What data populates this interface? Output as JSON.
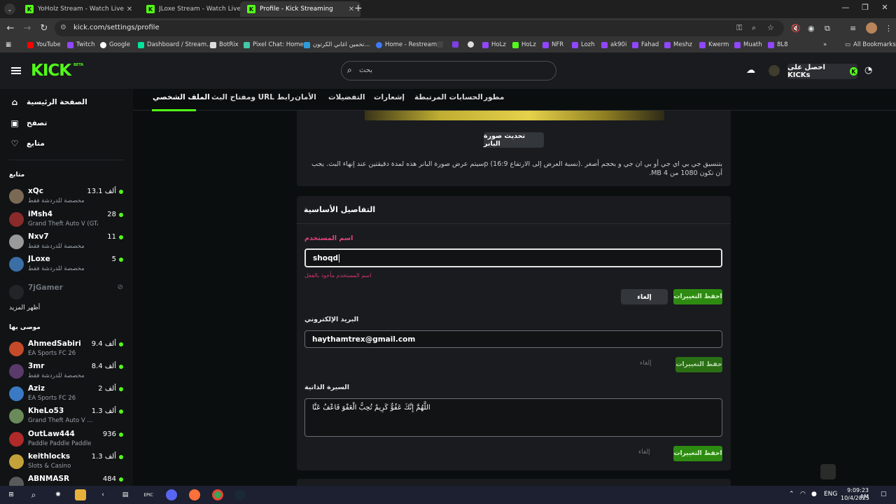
{
  "browser": {
    "tabs": [
      {
        "title": "YoHolz Stream - Watch Live on Kick",
        "active": false
      },
      {
        "title": "JLoxe Stream - Watch Live on Kick",
        "active": false
      },
      {
        "title": "Profile - Kick Streaming",
        "active": true
      }
    ],
    "new_tab_symbol": "+",
    "url": "kick.com/settings/profile",
    "bookmarks": [
      {
        "label": "YouTube",
        "color": "#ff0000"
      },
      {
        "label": "Twitch",
        "color": "#9146ff"
      },
      {
        "label": "Google",
        "color": "#ffffff"
      },
      {
        "label": "Dashboard / Stream...",
        "color": "#00e59b"
      },
      {
        "label": "BotRix",
        "color": "#dddddd"
      },
      {
        "label": "Pixel Chat: Home",
        "color": "#47c7a9"
      },
      {
        "label": "تخمين اغاني الكرتون...",
        "color": "#2d9cdb"
      },
      {
        "label": "Home - Restream",
        "color": "#3c7bff"
      },
      {
        "label": "",
        "color": "#444444"
      },
      {
        "label": "",
        "color": "#7b3fe4"
      },
      {
        "label": "",
        "color": "#dddddd"
      },
      {
        "label": "HoLz",
        "color": "#9146ff"
      },
      {
        "label": "HoLz",
        "color": "#53fc18"
      },
      {
        "label": "NFR",
        "color": "#9146ff"
      },
      {
        "label": "Lozh",
        "color": "#9146ff"
      },
      {
        "label": "ak90i",
        "color": "#9146ff"
      },
      {
        "label": "Fahad",
        "color": "#9146ff"
      },
      {
        "label": "Meshz",
        "color": "#9146ff"
      },
      {
        "label": "Kwerm",
        "color": "#9146ff"
      },
      {
        "label": "Muath",
        "color": "#9146ff"
      },
      {
        "label": "8L8",
        "color": "#9146ff"
      }
    ],
    "more_bookmarks": "»",
    "all_bookmarks": "All Bookmarks"
  },
  "header": {
    "logo": "KICK",
    "logo_badge": "BETA",
    "search_placeholder": "بحث",
    "get_kicks_label": "احصل على KICKs",
    "get_kicks_icon": "K"
  },
  "sidebar": {
    "nav": [
      {
        "label": "الصفحة الرئيسية",
        "icon": "home-icon",
        "glyph": "⌂"
      },
      {
        "label": "تصفح",
        "icon": "browse-icon",
        "glyph": "▣"
      },
      {
        "label": "متابع",
        "icon": "heart-icon",
        "glyph": "♡"
      }
    ],
    "following_heading": "متابع",
    "following": [
      {
        "name": "xQc",
        "category": "مخصصة للدردشة فقط",
        "viewers": "13.1 ألف",
        "live": true,
        "avatar": "#7a6a55"
      },
      {
        "name": "iMsh4",
        "category": "Grand Theft Auto V (GTA)",
        "viewers": "28",
        "live": true,
        "avatar": "#8a2a2a"
      },
      {
        "name": "Nxv7",
        "category": "مخصصة للدردشة فقط",
        "viewers": "11",
        "live": true,
        "avatar": "#9a9a9a"
      },
      {
        "name": "JLoxe",
        "category": "مخصصة للدردشة فقط",
        "viewers": "5",
        "live": true,
        "avatar": "#3a6ea5"
      },
      {
        "name": "7jGamer",
        "category": "",
        "viewers": "",
        "live": false,
        "avatar": "#2a2d31"
      }
    ],
    "show_more": "أظهر المزيد",
    "recommended_heading": "موصى بها",
    "recommended": [
      {
        "name": "AhmedSabiri",
        "category": "EA Sports FC 26",
        "viewers": "9.4 ألف",
        "avatar": "#c44a2a"
      },
      {
        "name": "3mr",
        "category": "مخصصة للدردشة فقط",
        "viewers": "8.4 ألف",
        "avatar": "#5a3a6a"
      },
      {
        "name": "Aziz",
        "category": "EA Sports FC 26",
        "viewers": "2 ألف",
        "avatar": "#3a7ac4"
      },
      {
        "name": "KheLo53",
        "category": "Grand Theft Auto V ...",
        "viewers": "1.3 ألف",
        "avatar": "#6a8a5a"
      },
      {
        "name": "OutLaw444",
        "category": "Paddle Paddle Paddle",
        "viewers": "936",
        "avatar": "#b02a2a"
      },
      {
        "name": "keithlocks",
        "category": "Slots & Casino",
        "viewers": "1.3 ألف",
        "avatar": "#c4a23a"
      },
      {
        "name": "ABNMASR",
        "category": "",
        "viewers": "484",
        "avatar": "#5a5a5a"
      }
    ]
  },
  "settings_tabs": [
    {
      "label": "الملف الشخصي",
      "active": true
    },
    {
      "label": "ومفتاح البث URL رابط",
      "active": false
    },
    {
      "label": "الأمان",
      "active": false
    },
    {
      "label": "التفضيلات",
      "active": false
    },
    {
      "label": "إشعارات",
      "active": false
    },
    {
      "label": "الحسابات المرتبطة",
      "active": false
    },
    {
      "label": "مطور",
      "active": false
    }
  ],
  "banner_section": {
    "update_button": "تحديث صورة البانر",
    "help_text": "بتنسيق جي بي اي جي أو بي ان جي و بحجم أصغر .(نسبة العرض إلى الارتفاع 16:9) pسيتم عرض صورة البانر هذه لمدة دقيقتين عند إنهاء البث. يجب أن تكون 1080 من 4 MB."
  },
  "basic_details": {
    "heading": "التفاصيل الأساسية",
    "username": {
      "label": "اسم المستخدم",
      "value": "shoqd",
      "error": "اسم المستخدم مأخوذ بالفعل",
      "cancel": "إلغاء",
      "save": "احفظ التغييرات",
      "label_color": "#e0457b"
    },
    "email": {
      "label": "البريد الإلكتروني",
      "value": "haythamtrex@gmail.com",
      "cancel": "إلغاء",
      "save": "حفظ التغييرات"
    },
    "bio": {
      "label": "السيرة الذاتية",
      "value": "اللَّهُمَّ إِنَّكَ عَفُوٌّ كَرِيمٌ تُحِبُّ الْعَفْوَ فَاعْفُ عَنَّا",
      "cancel": "إلغاء",
      "save": "احفظ التغييرات"
    }
  },
  "taskbar": {
    "language": "ENG",
    "time": "9:09:23 AM",
    "date": "10/4/2025"
  },
  "colors": {
    "accent": "#53fc18",
    "page_bg": "#0b0e0f",
    "card_bg": "#191b1f"
  }
}
